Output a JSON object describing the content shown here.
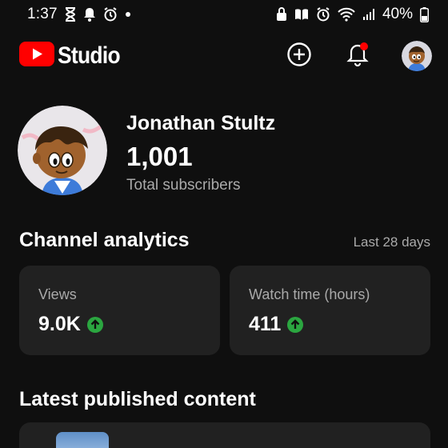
{
  "status_bar": {
    "time": "1:37",
    "battery": "40%",
    "icons": [
      "hourglass-icon",
      "bell-icon",
      "alarm-icon",
      "dot-icon",
      "lock-icon",
      "book-icon",
      "alarm-icon",
      "wifi-icon",
      "signal-icon",
      "battery-icon"
    ]
  },
  "header": {
    "brand": "Studio",
    "actions": [
      "create-icon",
      "notifications-icon",
      "account-avatar"
    ]
  },
  "channel": {
    "name": "Jonathan Stultz",
    "subscribers": "1,001",
    "subscribers_label": "Total subscribers"
  },
  "analytics": {
    "title": "Channel analytics",
    "period": "Last 28 days",
    "cards": [
      {
        "label": "Views",
        "value": "9.0K",
        "trend": "up"
      },
      {
        "label": "Watch time (hours)",
        "value": "411",
        "trend": "up"
      }
    ]
  },
  "latest": {
    "title": "Latest published content"
  },
  "colors": {
    "background": "#0f0f0f",
    "card": "#212121",
    "brand_red": "#ff0000",
    "trend_up": "#2ba640",
    "notification_dot": "#ff0000"
  }
}
